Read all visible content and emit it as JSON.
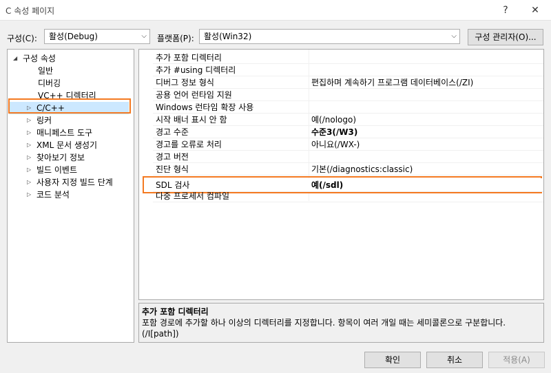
{
  "window": {
    "title": "C 속성 페이지",
    "help_glyph": "?",
    "close_glyph": "✕"
  },
  "toolbar": {
    "config_label": "구성(C):",
    "config_value": "활성(Debug)",
    "platform_label": "플랫폼(P):",
    "platform_value": "활성(Win32)",
    "config_manager_label": "구성 관리자(O)..."
  },
  "tree": {
    "root": "구성 속성",
    "items": [
      {
        "label": "일반"
      },
      {
        "label": "디버깅"
      },
      {
        "label": "VC++ 디렉터리"
      },
      {
        "label": "C/C++"
      },
      {
        "label": "링커"
      },
      {
        "label": "매니페스트 도구"
      },
      {
        "label": "XML 문서 생성기"
      },
      {
        "label": "찾아보기 정보"
      },
      {
        "label": "빌드 이벤트"
      },
      {
        "label": "사용자 지정 빌드 단계"
      },
      {
        "label": "코드 분석"
      }
    ],
    "selected": "C/C++"
  },
  "properties": [
    {
      "name": "추가 포함 디렉터리",
      "value": ""
    },
    {
      "name": "추가 #using 디렉터리",
      "value": ""
    },
    {
      "name": "디버그 정보 형식",
      "value": "편집하며 계속하기 프로그램 데이터베이스(/ZI)"
    },
    {
      "name": "공용 언어 런타임 지원",
      "value": ""
    },
    {
      "name": "Windows 런타임 확장 사용",
      "value": ""
    },
    {
      "name": "시작 배너 표시 안 함",
      "value": "예(/nologo)"
    },
    {
      "name": "경고 수준",
      "value": "수준3(/W3)"
    },
    {
      "name": "경고를 오류로 처리",
      "value": "아니요(/WX-)"
    },
    {
      "name": "경고 버전",
      "value": ""
    },
    {
      "name": "진단 형식",
      "value": "기본(/diagnostics:classic)"
    },
    {
      "name": "SDL 검사",
      "value": "예(/sdl)"
    },
    {
      "name": "다중 프로세서 컴파일",
      "value": ""
    }
  ],
  "description": {
    "title": "추가 포함 디렉터리",
    "text": "포함 경로에 추가할 하나 이상의 디렉터리를 지정합니다. 항목이 여러 개일 때는 세미콜론으로 구분합니다. (/I[path])"
  },
  "buttons": {
    "ok": "확인",
    "cancel": "취소",
    "apply": "적용(A)"
  },
  "colors": {
    "highlight": "#f47920"
  }
}
